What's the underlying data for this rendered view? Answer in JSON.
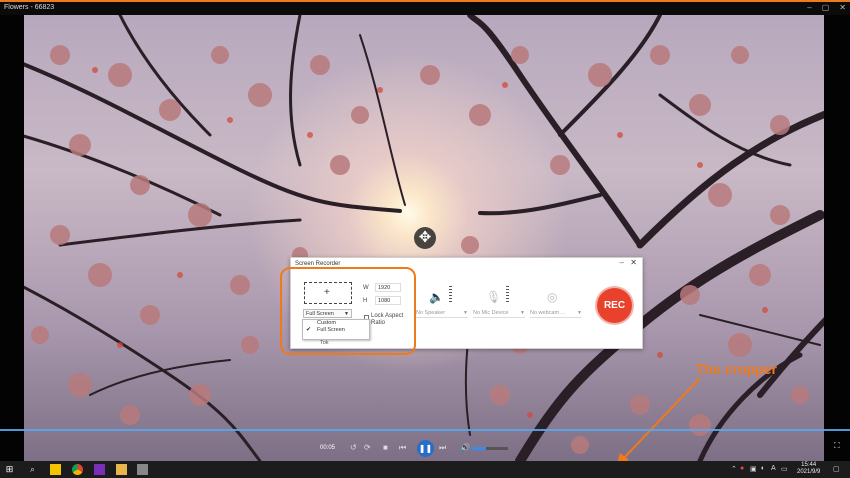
{
  "window": {
    "title": "Flowers - 66823",
    "controls": [
      "–",
      "▢",
      "✕"
    ],
    "accent": "#f07a1a"
  },
  "video": {
    "move_icon": "move-cross-icon"
  },
  "recorder": {
    "title": "Screen Recorder",
    "minimize": "–",
    "close": "✕",
    "width_label": "W",
    "width_value": "1920",
    "height_label": "H",
    "height_value": "1080",
    "size_selected": "Full Screen",
    "lock_aspect_label": "Lock Aspect Ratio",
    "dropdown_options": [
      {
        "label": "Custom",
        "checked": false
      },
      {
        "label": "Full Screen",
        "checked": true
      }
    ],
    "dropdown_partial": "Tok",
    "speaker_select": "No Speaker",
    "mic_select": "No Mic Device",
    "webcam_select": "No webcam ...",
    "rec_label": "REC",
    "rec_color": "#e8412c"
  },
  "annotation": {
    "text": "The cropper"
  },
  "player": {
    "time": "00:05",
    "buttons": [
      "↺",
      "⟳",
      "■",
      "⏮",
      "⏭"
    ],
    "play_icon": "pause-icon",
    "volume_fraction": 0.4,
    "fullscreen_icon": "fullscreen-icon"
  },
  "taskbar": {
    "tray_text": "A",
    "time": "15:44",
    "date": "2021/9/9"
  }
}
